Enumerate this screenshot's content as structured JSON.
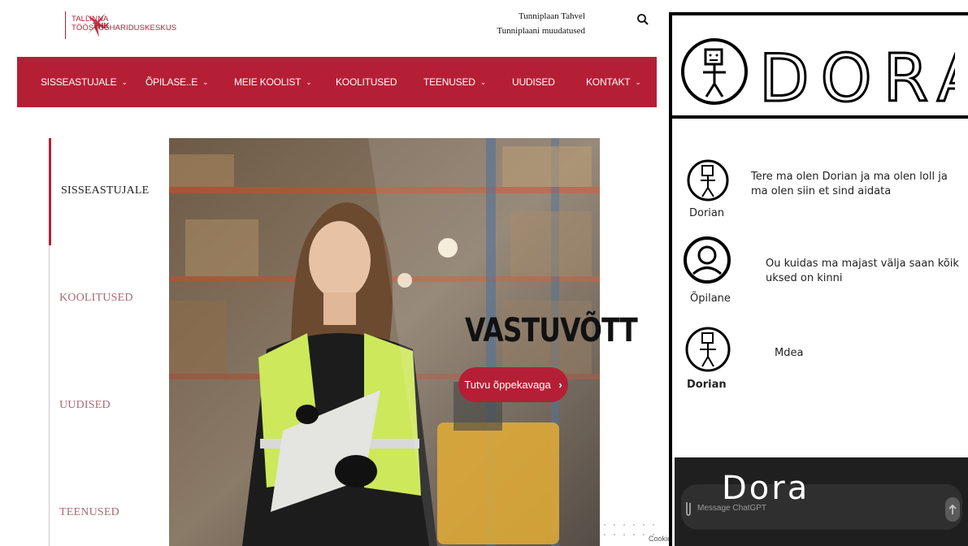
{
  "header": {
    "logo_abbr": "THK",
    "logo_line1": "TALLINNA",
    "logo_line2": "TÖÖSTUSHARIDUSKESKUS",
    "top_link_1": "Tunniplaan Tahvel",
    "top_link_2": "Tunniplaani muudatused",
    "search_icon": "search-icon"
  },
  "nav": {
    "items": [
      {
        "label": "SISSEASTUJALE",
        "dropdown": true
      },
      {
        "label": "ÕPILASE..E",
        "dropdown": true
      },
      {
        "label": "MEIE KOOLIST",
        "dropdown": true
      },
      {
        "label": "KOOLITUSED",
        "dropdown": false
      },
      {
        "label": "TEENUSED",
        "dropdown": true
      },
      {
        "label": "UUDISED",
        "dropdown": false
      },
      {
        "label": "KONTAKT",
        "dropdown": true
      }
    ],
    "chevron_icon": "chevron-down-icon"
  },
  "side_menu": {
    "items": [
      {
        "label": "SISSEASTUJALE",
        "active": true
      },
      {
        "label": "KOOLITUSED",
        "active": false
      },
      {
        "label": "UUDISED",
        "active": false
      },
      {
        "label": "TEENUSED",
        "active": false
      }
    ]
  },
  "hero": {
    "title": "VASTUVÕTT",
    "button_label": "Tutvu õppekavaga",
    "button_icon": "chevron-right-icon",
    "cookie_label": "Cookie"
  },
  "chat": {
    "title": "DORA",
    "messages": [
      {
        "sender": "Dorian",
        "text": "Tere ma olen Dorian ja ma olen loll ja ma olen siin et sind aidata",
        "avatar": "stick-figure-icon"
      },
      {
        "sender": "Õpilane",
        "text": "Ou kuidas ma majast välja saan kõik uksed on kinni",
        "avatar": "user-icon"
      },
      {
        "sender": "Dorian",
        "text": "Mdea",
        "avatar": "stick-figure-icon"
      }
    ],
    "input_placeholder": "Message ChatGPT",
    "input_overlay": "Dora",
    "attach_icon": "paperclip-icon",
    "send_icon": "send-arrow-icon"
  },
  "colors": {
    "brand": "#b51f35",
    "chat_input_bg": "#1f1f1f"
  }
}
